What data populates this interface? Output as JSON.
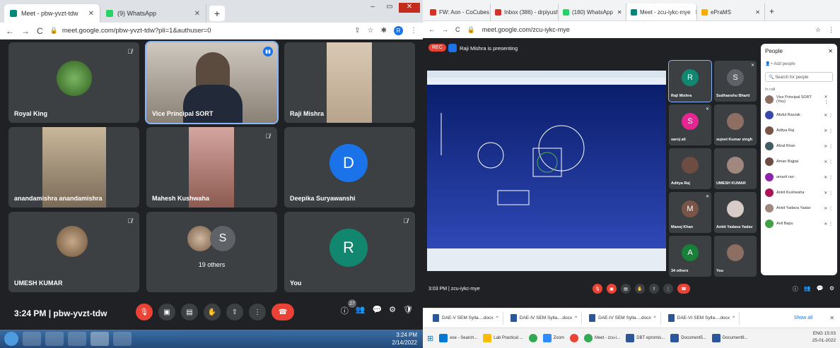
{
  "left": {
    "tabs": [
      {
        "label": "Meet - pbw-yvzt-tdw",
        "active": true,
        "color": "#00897b"
      },
      {
        "label": "(9) WhatsApp",
        "active": false,
        "color": "#25d366"
      }
    ],
    "url": "meet.google.com/pbw-yvzt-tdw?pli=1&authuser=0",
    "tiles": [
      {
        "name": "Royal King",
        "kind": "photo"
      },
      {
        "name": "Vice Principal SORT",
        "kind": "photo",
        "active": true
      },
      {
        "name": "Raji Mishra",
        "kind": "photo"
      },
      {
        "name": "anandamishra anandamishra",
        "kind": "photo"
      },
      {
        "name": "Mahesh Kushwaha",
        "kind": "photo"
      },
      {
        "name": "Deepika Suryawanshi",
        "kind": "avatar",
        "initial": "D",
        "color": "#1a73e8"
      },
      {
        "name": "UMESH KUMAR",
        "kind": "photo"
      },
      {
        "name": "19 others",
        "kind": "others",
        "initial": "S",
        "color": "#5f6368"
      },
      {
        "name": "You",
        "kind": "avatar",
        "initial": "R",
        "color": "#12876f"
      }
    ],
    "meeting_time": "3:24 PM",
    "meeting_code": "pbw-yvzt-tdw",
    "people_count": "27",
    "taskbar_time": "3:24 PM",
    "taskbar_date": "2/14/2022"
  },
  "right": {
    "tabs": [
      {
        "label": "FW: Aon - CoCubes Invit",
        "color": "#d93025"
      },
      {
        "label": "Inbox (386) - drpiyushku",
        "color": "#d93025"
      },
      {
        "label": "(180) WhatsApp",
        "color": "#25d366"
      },
      {
        "label": "Meet - zcu-iykc-mye",
        "color": "#00897b",
        "active": true
      },
      {
        "label": "ePraMS",
        "color": "#f9ab00"
      }
    ],
    "url": "meet.google.com/zcu-iykc-mye",
    "rec_label": "REC",
    "presenting_label": "Raji Mishra is presenting",
    "tiles": [
      {
        "name": "Raji Mishra",
        "initial": "R",
        "color": "#12876f",
        "active": true
      },
      {
        "name": "Sudhanshu Bharti",
        "initial": "S",
        "color": "#5f6368"
      },
      {
        "name": "saroj ali",
        "initial": "S",
        "color": "#e52592"
      },
      {
        "name": "sujeet Kumar singh",
        "initial": "",
        "color": ""
      },
      {
        "name": "Aditya Raj",
        "initial": "",
        "color": ""
      },
      {
        "name": "UMESH KUMAR",
        "initial": "",
        "color": ""
      },
      {
        "name": "Manoj Khan",
        "initial": "M",
        "color": "#795548"
      },
      {
        "name": "Ankit Yadava Yadav",
        "initial": "",
        "color": ""
      },
      {
        "name": "34 others",
        "initial": "A",
        "color": "#188038"
      },
      {
        "name": "You",
        "initial": "",
        "color": ""
      }
    ],
    "people": {
      "title": "People",
      "add": "Add people",
      "search_placeholder": "Search for people",
      "in_call": "In call",
      "list": [
        {
          "name": "Vice Principal SORT (You)",
          "color": "#8d6e63"
        },
        {
          "name": "Abdul Razzak",
          "color": "#3949ab"
        },
        {
          "name": "Aditya Raj",
          "color": "#795548"
        },
        {
          "name": "Afzal Khan",
          "color": "#455a64"
        },
        {
          "name": "Aman Bajpai",
          "color": "#6d4c41"
        },
        {
          "name": "amarit rao",
          "color": "#8e24aa"
        },
        {
          "name": "Ankit Kushwaha",
          "color": "#ad1457"
        },
        {
          "name": "Ankit Yadava Yadav",
          "color": "#a1887f"
        },
        {
          "name": "Anil Bapu",
          "color": "#43a047"
        }
      ]
    },
    "meeting_time": "3:03 PM",
    "meeting_code": "zcu-iykc-mye",
    "downloads": [
      "DAE-V SEM Sylla....docx",
      "DAE-IV SEM Sylla....docx",
      "DAE-IV SEM Sylla....docx",
      "DAE-VI SEM Sylla....docx"
    ],
    "show_all": "Show all",
    "taskbar": [
      {
        "label": "ese - Search...",
        "color": "#0078d4"
      },
      {
        "label": "Lab Practical ...",
        "color": "#fbbc04"
      },
      {
        "label": "",
        "color": "#34a853"
      },
      {
        "label": "Zoom",
        "color": "#2d8cff"
      },
      {
        "label": "",
        "color": "#ea4335"
      },
      {
        "label": "Meet - zcu-i...",
        "color": "#34a853"
      },
      {
        "label": "DBT epromis...",
        "color": "#2b579a"
      },
      {
        "label": "Document5...",
        "color": "#2b579a"
      },
      {
        "label": "Document8...",
        "color": "#2b579a"
      }
    ],
    "tray_lang": "ENG",
    "tray_time": "15:03",
    "tray_date": "25-01-2022"
  }
}
